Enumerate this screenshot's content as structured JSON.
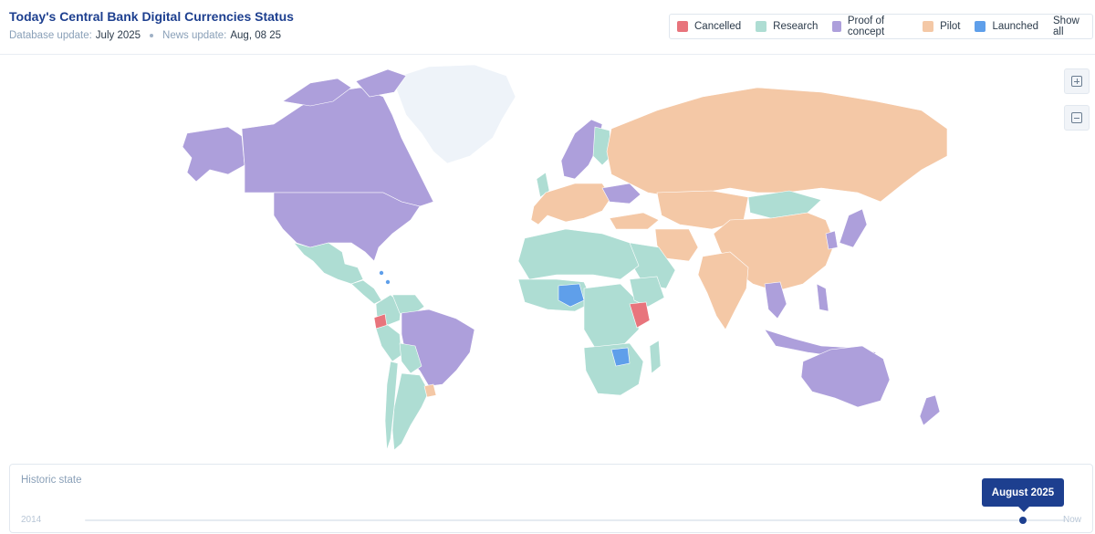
{
  "header": {
    "title": "Today's Central Bank Digital Currencies Status",
    "database_update_label": "Database update:",
    "database_update_value": "July 2025",
    "news_update_label": "News update:",
    "news_update_value": "Aug, 08 25"
  },
  "legend": {
    "items": [
      {
        "label": "Cancelled",
        "color": "#e8747c"
      },
      {
        "label": "Research",
        "color": "#aeddd3"
      },
      {
        "label": "Proof of concept",
        "color": "#ad9fdb"
      },
      {
        "label": "Pilot",
        "color": "#f4c8a6"
      },
      {
        "label": "Launched",
        "color": "#5f9fea"
      }
    ],
    "show_all_label": "Show all"
  },
  "map": {
    "no_data_color": "#eef3f9",
    "zoom_in_icon": "plus-square-icon",
    "zoom_out_icon": "minus-square-icon",
    "highlighted_countries": {
      "cancelled": [
        "Ecuador",
        "Kenya"
      ],
      "launched": [
        "Nigeria",
        "Zimbabwe",
        "Jamaica",
        "Bahamas"
      ],
      "proof_of_concept": [
        "Canada",
        "United States",
        "Alaska (US)",
        "Brazil",
        "Australia",
        "New Zealand",
        "Indonesia",
        "Thailand",
        "Norway",
        "Sweden",
        "Ukraine",
        "Japan",
        "South Korea",
        "Philippines"
      ],
      "pilot": [
        "Russia",
        "China",
        "India",
        "Iran",
        "Saudi Arabia",
        "France",
        "Germany",
        "Turkey",
        "Uruguay"
      ]
    }
  },
  "historic": {
    "label": "Historic state",
    "start_label": "2014",
    "end_label": "Now",
    "current_label": "August 2025",
    "position_fraction": 0.95
  }
}
